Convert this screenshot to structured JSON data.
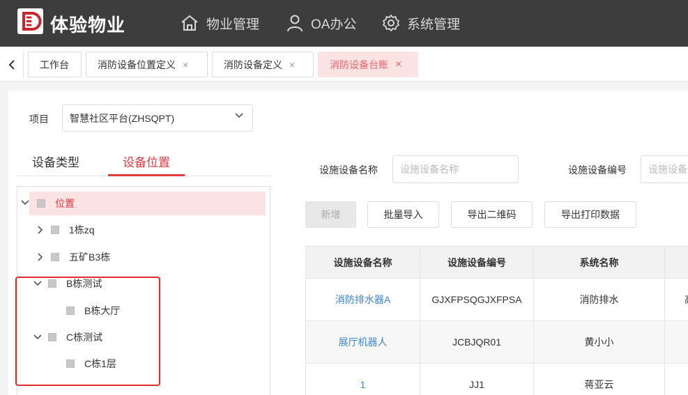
{
  "brand": {
    "name": "体验物业"
  },
  "nav": {
    "items": [
      {
        "label": "物业管理",
        "icon": "home-icon"
      },
      {
        "label": "OA办公",
        "icon": "user-icon"
      },
      {
        "label": "系统管理",
        "icon": "gear-icon"
      }
    ]
  },
  "tabs": {
    "items": [
      {
        "label": "工作台"
      },
      {
        "label": "消防设备位置定义",
        "closable": "×"
      },
      {
        "label": "消防设备定义",
        "closable": "×"
      },
      {
        "label": "消防设备台账",
        "closable": "×",
        "active": true
      }
    ]
  },
  "project": {
    "label": "项目",
    "value": "智慧社区平台(ZHSQPT)"
  },
  "left_tabs": {
    "type": "设备类型",
    "location": "设备位置"
  },
  "tree": {
    "nodes": [
      {
        "label": "位置",
        "expanded": true,
        "selected": true
      },
      {
        "label": "1栋zq",
        "expanded": false
      },
      {
        "label": "五矿B3栋",
        "expanded": false
      },
      {
        "label": "B栋测试",
        "expanded": true
      },
      {
        "label": "B栋大厅"
      },
      {
        "label": "C栋测试",
        "expanded": true
      },
      {
        "label": "C栋1层"
      }
    ]
  },
  "filters": {
    "name_label": "设施设备名称",
    "name_placeholder": "设施设备名称",
    "code_label": "设施设备编号",
    "code_placeholder": "设施设备编号"
  },
  "buttons": {
    "add": "新增",
    "batch_import": "批量导入",
    "export_qr": "导出二维码",
    "export_print": "导出打印数据"
  },
  "table": {
    "headers": [
      "设施设备名称",
      "设施设备编号",
      "系统名称"
    ],
    "rows": [
      {
        "name": "消防排水器A",
        "code": "GJXFPSQGJXFPSA",
        "system": "消防排水",
        "extra": "高"
      },
      {
        "name": "展厅机器人",
        "code": "JCBJQR01",
        "system": "黄小小",
        "extra": ""
      },
      {
        "name": "1",
        "code": "JJ1",
        "system": "蒋亚云",
        "extra": ""
      }
    ]
  },
  "colors": {
    "accent": "#e0393e",
    "topbar": "#3d3d3d",
    "link": "#3a86d4",
    "highlight_box": "#e02b2b"
  }
}
